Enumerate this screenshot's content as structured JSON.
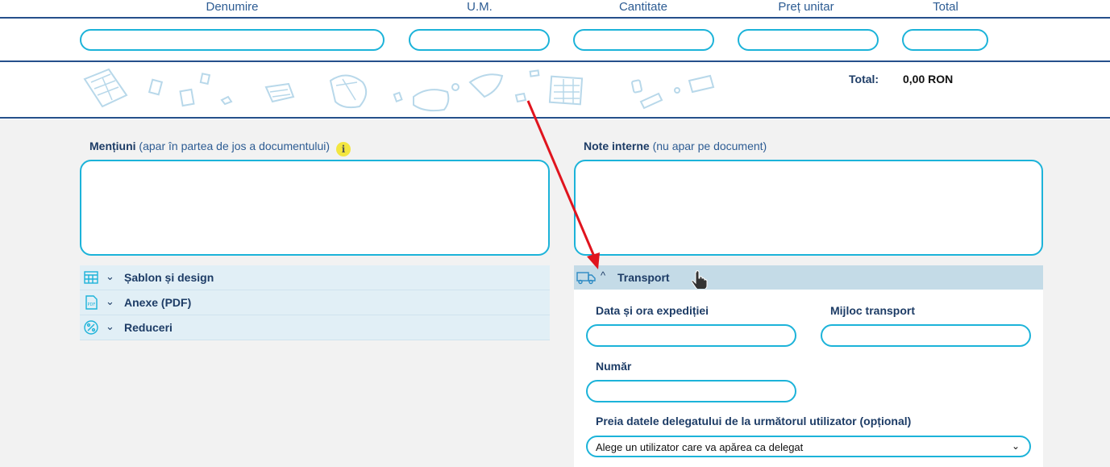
{
  "table": {
    "columns": [
      "Denumire",
      "U.M.",
      "Cantitate",
      "Preț unitar",
      "Total"
    ],
    "total_label": "Total:",
    "total_value": "0,00 RON"
  },
  "mentions": {
    "label_bold": "Mențiuni",
    "label_note": " (apar în partea de jos a documentului)",
    "info_glyph": "i",
    "value": ""
  },
  "internal_notes": {
    "label_bold": "Note interne",
    "label_note": " (nu apar pe document)",
    "value": ""
  },
  "sections": [
    {
      "label": "Șablon și design",
      "icon": "template-icon",
      "chevron": "⌄"
    },
    {
      "label": "Anexe (PDF)",
      "icon": "pdf-icon",
      "chevron": "⌄"
    },
    {
      "label": "Reduceri",
      "icon": "discount-icon",
      "chevron": "⌄"
    }
  ],
  "transport": {
    "title": "Transport",
    "chevron": "^",
    "icon": "truck-icon",
    "fields": {
      "date_label": "Data și ora expediției",
      "vehicle_label": "Mijloc transport",
      "number_label": "Număr",
      "delegate_label": "Preia datele delegatului de la următorul utilizator (opțional)",
      "delegate_selected": "Alege un utilizator care va apărea ca delegat"
    }
  },
  "colors": {
    "accent": "#1cb3d9",
    "heading": "#1d3c66",
    "annotation_arrow": "#e0141e"
  }
}
